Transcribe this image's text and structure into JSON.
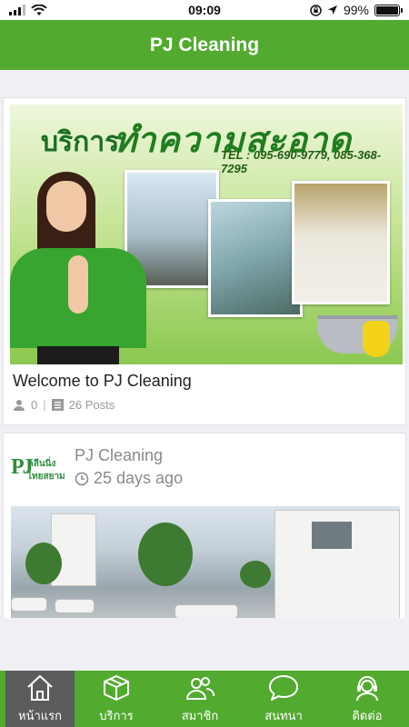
{
  "status_bar": {
    "time": "09:09",
    "battery": "99%"
  },
  "header": {
    "title": "PJ Cleaning"
  },
  "feed": {
    "posts": [
      {
        "banner": {
          "word1": "บริการ",
          "word2": "ทำความสะอาด",
          "tel": "TEL : 095-690-9779, 085-368-7295"
        },
        "title": "Welcome to PJ Cleaning",
        "members": "0",
        "posts_count": "26 Posts"
      },
      {
        "author": "PJ Cleaning",
        "time": "25 days ago",
        "logo": {
          "mark": "PJ",
          "line1": "คลีนนิ่ง",
          "line2": "ไทยสยาม"
        }
      }
    ]
  },
  "tab_bar": {
    "items": [
      {
        "label": "หน้าแรก",
        "icon": "home-icon",
        "active": true
      },
      {
        "label": "บริการ",
        "icon": "box-icon"
      },
      {
        "label": "สมาชิก",
        "icon": "members-icon"
      },
      {
        "label": "สนทนา",
        "icon": "chat-icon"
      },
      {
        "label": "ติดต่อ",
        "icon": "support-icon"
      }
    ]
  },
  "colors": {
    "brand_green": "#52ab2f",
    "active_tab": "#5c5c5c"
  }
}
